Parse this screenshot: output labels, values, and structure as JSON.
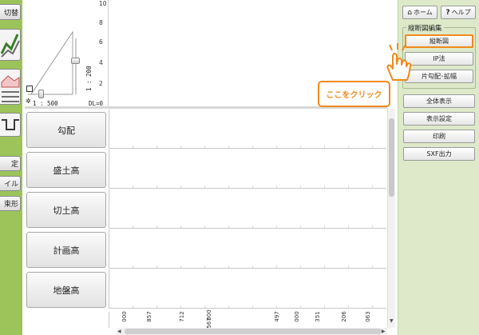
{
  "left_toolbar": {
    "items": [
      {
        "label": "切替"
      },
      {
        "label": "定"
      },
      {
        "label": "イル"
      },
      {
        "label": "束形"
      }
    ]
  },
  "preview": {
    "scale_horizontal": "1 : 500",
    "scale_vertical": "1 : 200",
    "dl_label": "DL=0"
  },
  "top_chart": {
    "y_ticks": [
      "10",
      "8",
      "6",
      "4",
      "2"
    ]
  },
  "rows": [
    {
      "label": "勾配"
    },
    {
      "label": "盛土高"
    },
    {
      "label": "切土高"
    },
    {
      "label": "計画高"
    },
    {
      "label": "地盤高"
    }
  ],
  "bottom_axis": {
    "labels": [
      "000",
      "857",
      "712",
      "000",
      "567",
      "497",
      "000",
      "351",
      "206",
      "063"
    ]
  },
  "right_panel": {
    "home_label": "ホーム",
    "help_label": "ヘルプ",
    "group_title": "縦断図編集",
    "group_buttons": [
      "縦断図",
      "IP法",
      "片勾配･拡幅"
    ],
    "buttons": [
      "全体表示",
      "表示設定",
      "印刷",
      "SXF出力"
    ]
  },
  "callout": {
    "text": "ここをクリック"
  },
  "colors": {
    "accent": "#f08a1c",
    "toolbar_green": "#9cc45a",
    "panel_green": "#dde9c9"
  }
}
